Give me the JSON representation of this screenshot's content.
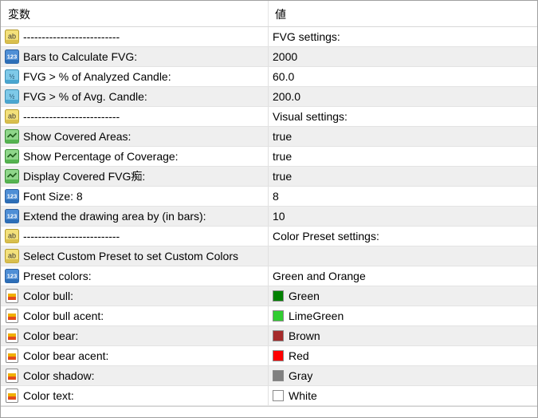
{
  "header": {
    "col_name": "変数",
    "col_value": "値"
  },
  "rows": [
    {
      "icon": "ab",
      "name": "--------------------------",
      "value": "FVG settings:"
    },
    {
      "icon": "123",
      "name": "Bars to Calculate FVG:",
      "value": "2000"
    },
    {
      "icon": "frac",
      "name": "FVG > % of Analyzed Candle:",
      "value": "60.0"
    },
    {
      "icon": "frac",
      "name": "FVG > % of Avg. Candle:",
      "value": "200.0"
    },
    {
      "icon": "ab",
      "name": "--------------------------",
      "value": "Visual settings:"
    },
    {
      "icon": "bool",
      "name": "Show Covered Areas:",
      "value": "true"
    },
    {
      "icon": "bool",
      "name": "Show Percentage of Coverage:",
      "value": "true"
    },
    {
      "icon": "bool",
      "name": "Display Covered FVG痴:",
      "value": "true"
    },
    {
      "icon": "123",
      "name": "Font Size: 8",
      "value": "8"
    },
    {
      "icon": "123",
      "name": "Extend the drawing area by (in bars):",
      "value": "10"
    },
    {
      "icon": "ab",
      "name": "--------------------------",
      "value": "Color Preset settings:"
    },
    {
      "icon": "ab",
      "name": "Select Custom Preset to set Custom Colors",
      "value": ""
    },
    {
      "icon": "123",
      "name": "Preset colors:",
      "value": "Green and Orange"
    },
    {
      "icon": "color",
      "name": "Color bull:",
      "value": "Green",
      "swatch": "#008000"
    },
    {
      "icon": "color",
      "name": "Color bull acent:",
      "value": "LimeGreen",
      "swatch": "#32cd32"
    },
    {
      "icon": "color",
      "name": "Color bear:",
      "value": "Brown",
      "swatch": "#a52a2a"
    },
    {
      "icon": "color",
      "name": "Color bear acent:",
      "value": "Red",
      "swatch": "#ff0000"
    },
    {
      "icon": "color",
      "name": "Color shadow:",
      "value": "Gray",
      "swatch": "#808080"
    },
    {
      "icon": "color",
      "name": "Color text:",
      "value": "White",
      "swatch": "#ffffff"
    }
  ]
}
